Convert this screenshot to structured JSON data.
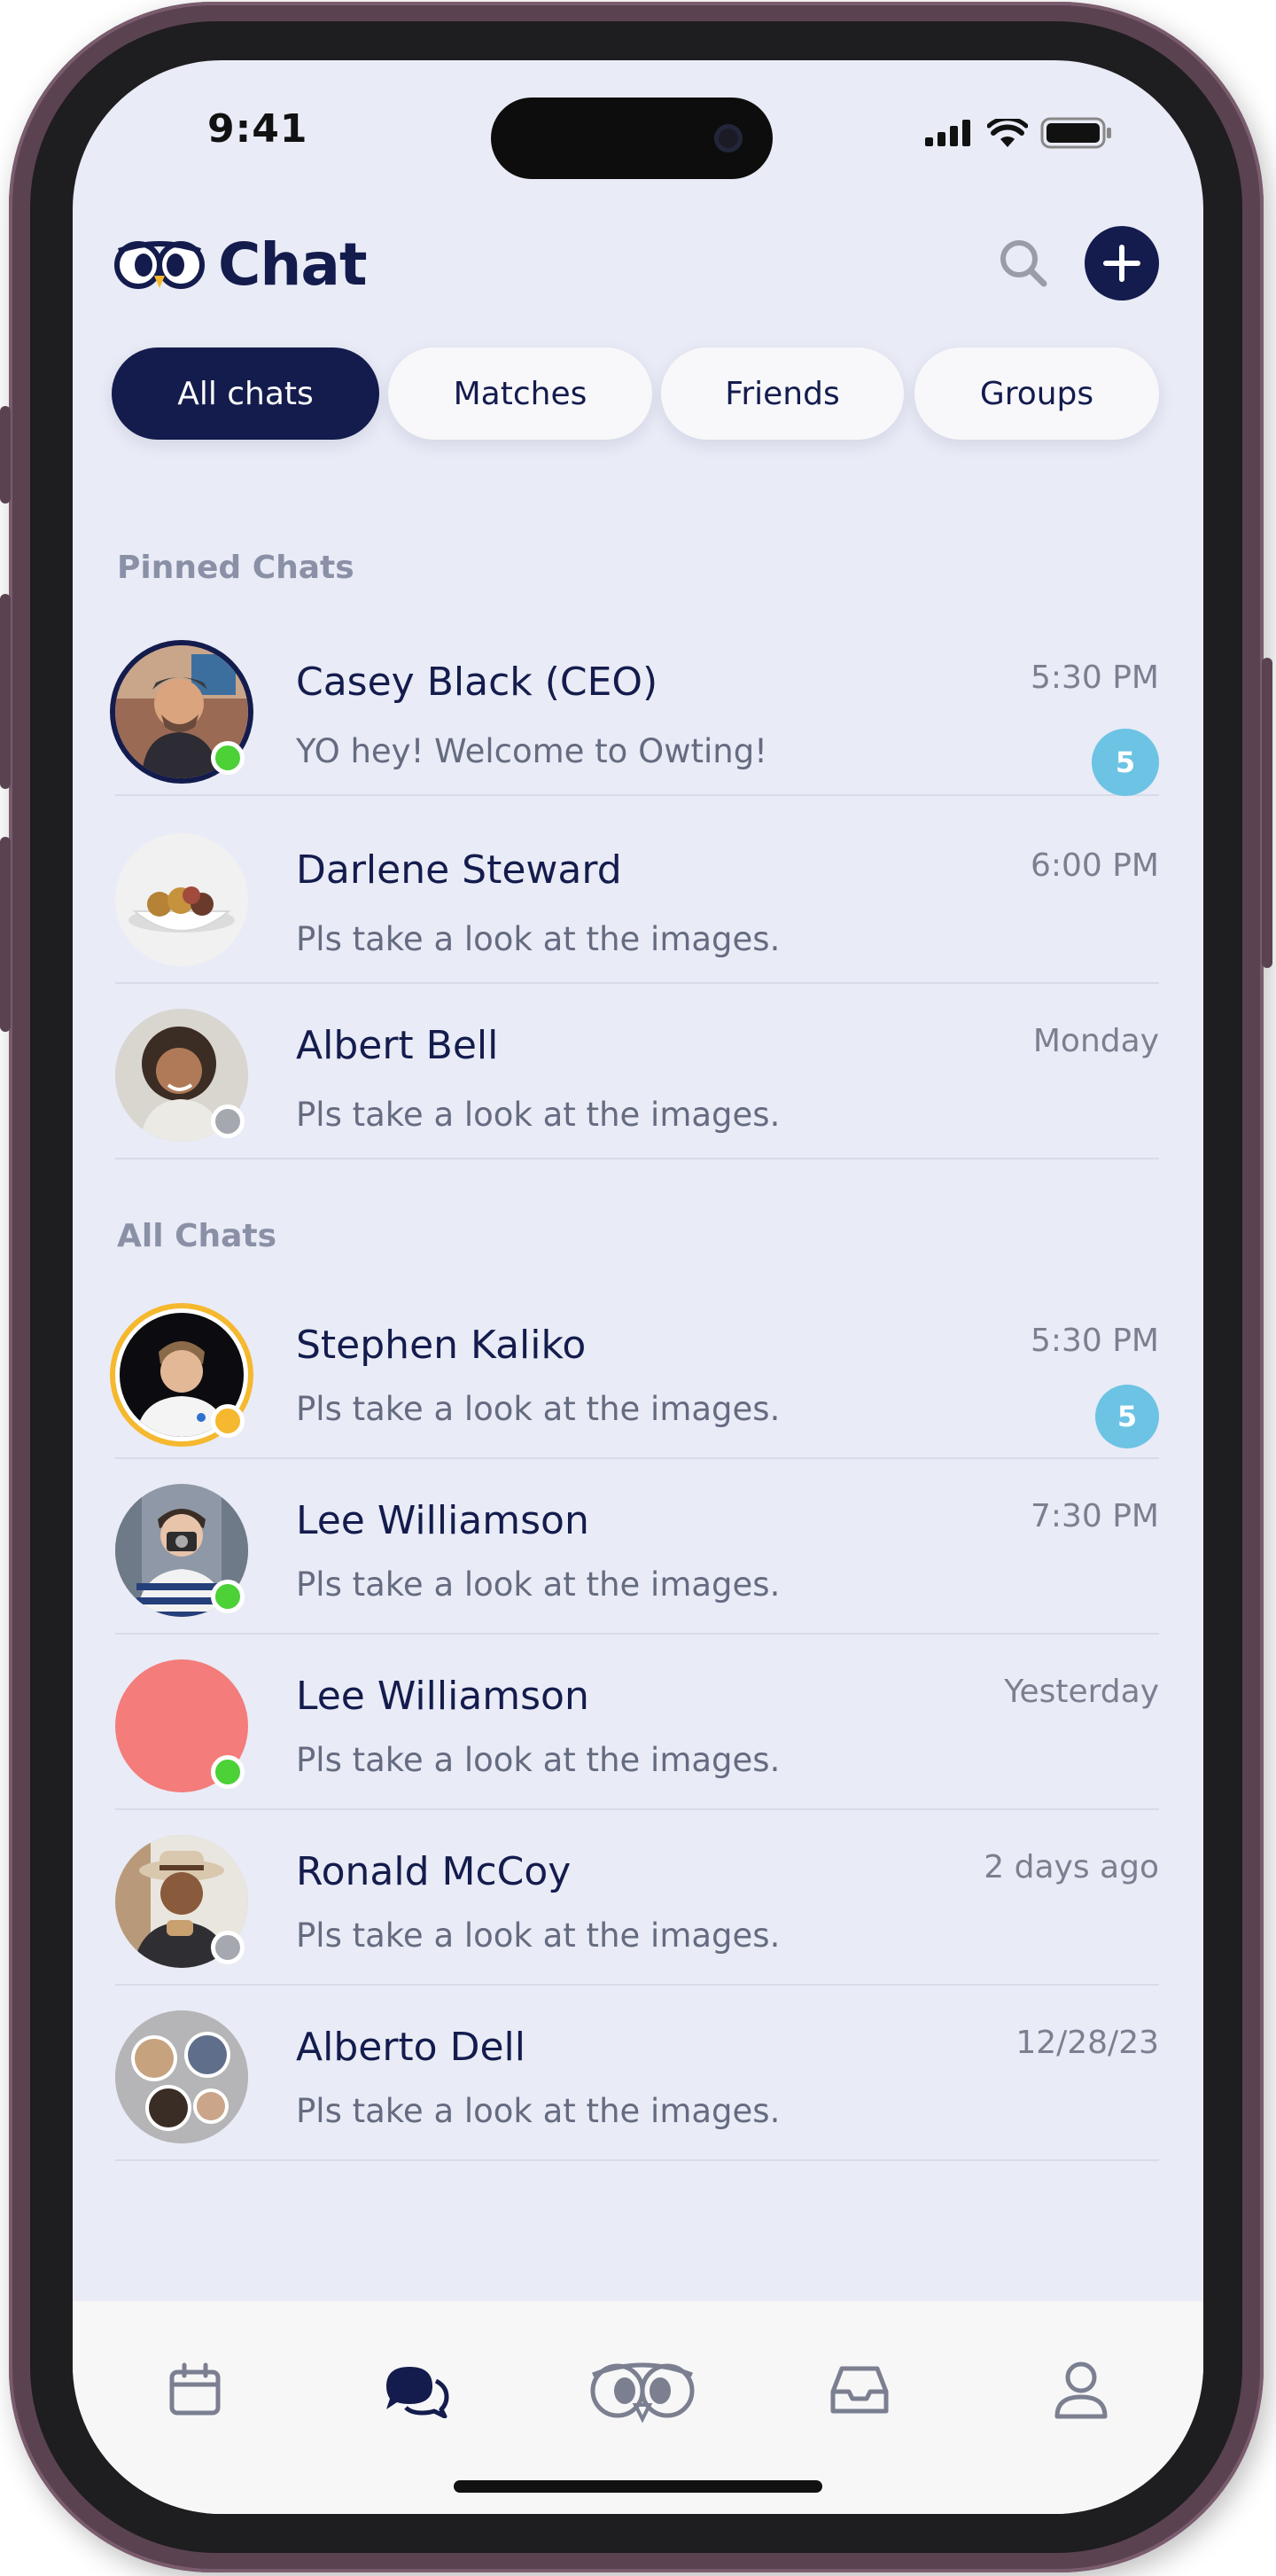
{
  "status_bar": {
    "time": "9:41"
  },
  "header": {
    "title": "Chat"
  },
  "tabs": [
    {
      "label": "All chats",
      "active": true
    },
    {
      "label": "Matches",
      "active": false
    },
    {
      "label": "Friends",
      "active": false
    },
    {
      "label": "Groups",
      "active": false
    }
  ],
  "pinned": {
    "title": "Pinned Chats",
    "chats": [
      {
        "name": "Casey Black (CEO)",
        "message": "YO hey! Welcome to Owting!",
        "time": "5:30 PM",
        "unread": "5",
        "presence": "online"
      },
      {
        "name": "Darlene Steward",
        "message": "Pls take a look at the images.",
        "time": "6:00 PM",
        "unread": "",
        "presence": "none"
      },
      {
        "name": "Albert Bell",
        "message": "Pls take a look at the images.",
        "time": "Monday",
        "unread": "",
        "presence": "offline"
      }
    ]
  },
  "all": {
    "title": "All Chats",
    "chats": [
      {
        "name": "Stephen Kaliko",
        "message": "Pls take a look at the images.",
        "time": "5:30 PM",
        "unread": "5",
        "presence": "away"
      },
      {
        "name": "Lee Williamson",
        "message": "Pls take a look at the images.",
        "time": "7:30 PM",
        "unread": "",
        "presence": "online"
      },
      {
        "name": "Lee Williamson",
        "message": "Pls take a look at the images.",
        "time": "Yesterday",
        "unread": "",
        "presence": "online"
      },
      {
        "name": "Ronald McCoy",
        "message": "Pls take a look at the images.",
        "time": "2 days ago",
        "unread": "",
        "presence": "offline"
      },
      {
        "name": "Alberto Dell",
        "message": "Pls take a look at the images.",
        "time": "12/28/23",
        "unread": "",
        "presence": "none"
      }
    ]
  },
  "nav": [
    {
      "icon": "calendar-icon",
      "active": false
    },
    {
      "icon": "chat-bubbles-icon",
      "active": true
    },
    {
      "icon": "owl-icon",
      "active": false
    },
    {
      "icon": "inbox-icon",
      "active": false
    },
    {
      "icon": "profile-icon",
      "active": false
    }
  ],
  "colors": {
    "navy": "#141c4d",
    "badge": "#6cc3e4",
    "online": "#4cd137",
    "away": "#f5b82e",
    "offline": "#a6a8b0",
    "background": "#e9ebf6"
  }
}
